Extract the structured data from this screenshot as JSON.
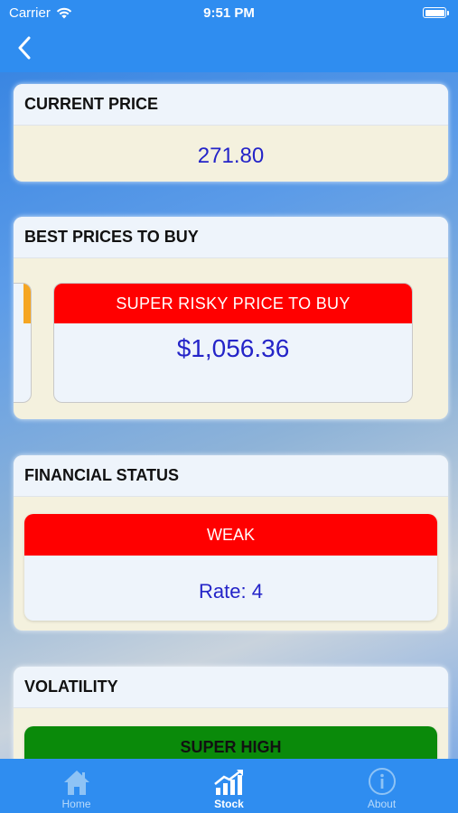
{
  "status_bar": {
    "carrier": "Carrier",
    "time": "9:51 PM"
  },
  "nav": {
    "back_icon": "chevron-left-icon"
  },
  "current_price": {
    "header": "CURRENT PRICE",
    "value": "271.80"
  },
  "best_prices": {
    "header": "BEST PRICES TO BUY",
    "box_title": "SUPER RISKY PRICE TO BUY",
    "box_value": "$1,056.36",
    "box_color": "#ff0000",
    "prev_box_color": "#f5a623"
  },
  "financial_status": {
    "header": "FINANCIAL STATUS",
    "status": "WEAK",
    "rate": "Rate: 4",
    "status_color": "#ff0000"
  },
  "volatility": {
    "header": "VOLATILITY",
    "status": "SUPER HIGH",
    "status_color": "#0a8a0a"
  },
  "tab_bar": {
    "items": [
      {
        "label": "Home",
        "icon": "home-icon",
        "active": false
      },
      {
        "label": "Stock",
        "icon": "chart-icon",
        "active": true
      },
      {
        "label": "About",
        "icon": "info-icon",
        "active": false
      }
    ]
  },
  "colors": {
    "accent": "#2f8df0",
    "value_text": "#2424c8",
    "card_bg": "#f4f1de",
    "header_bg": "#eef4fb"
  }
}
